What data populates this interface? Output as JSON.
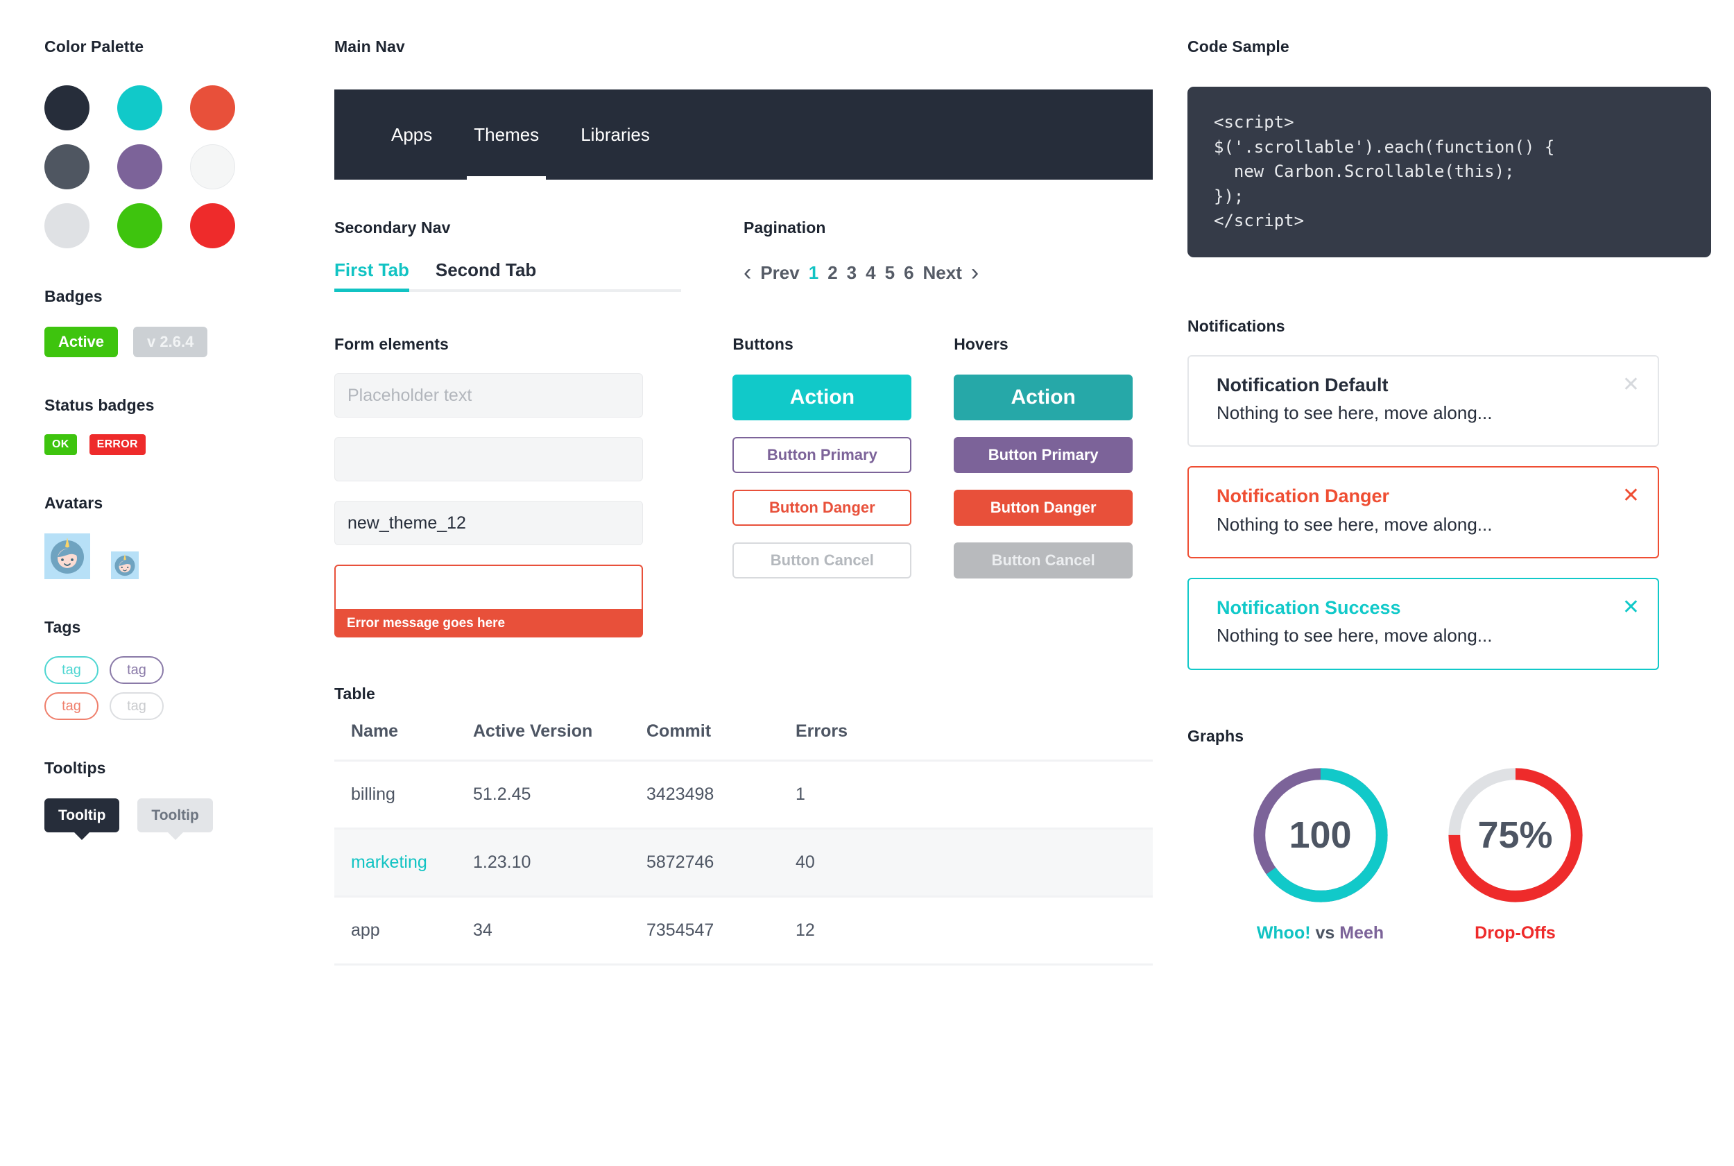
{
  "left": {
    "palette": {
      "title": "Color Palette",
      "swatches": [
        {
          "name": "dark-navy",
          "hex": "#262d3a",
          "ring": false
        },
        {
          "name": "teal",
          "hex": "#11c9c9",
          "ring": false
        },
        {
          "name": "coral",
          "hex": "#e8503a",
          "ring": false
        },
        {
          "name": "slate",
          "hex": "#4f5661",
          "ring": false
        },
        {
          "name": "purple",
          "hex": "#7c6399",
          "ring": false
        },
        {
          "name": "off-white",
          "hex": "#f5f6f6",
          "ring": true
        },
        {
          "name": "light-gray",
          "hex": "#dfe1e4",
          "ring": false
        },
        {
          "name": "green",
          "hex": "#3ec40e",
          "ring": false
        },
        {
          "name": "red",
          "hex": "#ee2b2b",
          "ring": false
        }
      ]
    },
    "badges": {
      "title": "Badges",
      "active_label": "Active",
      "active_color": "#3ec40e",
      "version_label": "v 2.6.4"
    },
    "status_badges": {
      "title": "Status badges",
      "ok_label": "OK",
      "ok_color": "#3ec40e",
      "error_label": "ERROR",
      "error_color": "#ee2b2b"
    },
    "avatars": {
      "title": "Avatars"
    },
    "tags": {
      "title": "Tags",
      "items": [
        {
          "label": "tag",
          "color": "#4fd6d2"
        },
        {
          "label": "tag",
          "color": "#8a7aa8"
        },
        {
          "label": "tag",
          "color": "#ef7f6c"
        },
        {
          "label": "tag",
          "color": "#c9cbce"
        }
      ]
    },
    "tooltips": {
      "title": "Tooltips",
      "dark_label": "Tooltip",
      "light_label": "Tooltip"
    }
  },
  "center": {
    "main_nav": {
      "title": "Main Nav",
      "items": [
        {
          "label": "Apps",
          "active": false
        },
        {
          "label": "Themes",
          "active": true
        },
        {
          "label": "Libraries",
          "active": false
        }
      ]
    },
    "secondary_nav": {
      "title": "Secondary Nav",
      "tabs": [
        {
          "label": "First Tab",
          "active": true
        },
        {
          "label": "Second Tab",
          "active": false
        }
      ]
    },
    "pagination": {
      "title": "Pagination",
      "prev_label": "Prev",
      "next_label": "Next",
      "prev_icon": "chevron-left-icon",
      "next_icon": "chevron-right-icon",
      "pages": [
        "1",
        "2",
        "3",
        "4",
        "5",
        "6"
      ],
      "current_page": "1"
    },
    "form": {
      "title": "Form elements",
      "placeholder": "Placeholder text",
      "empty_value": "",
      "filled_value": "new_theme_12",
      "error_value": "",
      "error_message": "Error message goes here"
    },
    "buttons": {
      "title": "Buttons",
      "action": "Action",
      "primary": "Button Primary",
      "danger": "Button Danger",
      "cancel": "Button Cancel"
    },
    "hovers": {
      "title": "Hovers",
      "action": "Action",
      "primary": "Button Primary",
      "danger": "Button Danger",
      "cancel": "Button Cancel"
    },
    "table": {
      "title": "Table",
      "columns": [
        "Name",
        "Active Version",
        "Commit",
        "Errors"
      ],
      "rows": [
        {
          "name": "billing",
          "version": "51.2.45",
          "commit": "3423498",
          "errors": "1",
          "highlight": false,
          "link": false
        },
        {
          "name": "marketing",
          "version": "1.23.10",
          "commit": "5872746",
          "errors": "40",
          "highlight": true,
          "link": true
        },
        {
          "name": "app",
          "version": "34",
          "commit": "7354547",
          "errors": "12",
          "highlight": false,
          "link": false
        }
      ]
    }
  },
  "right": {
    "code": {
      "title": "Code Sample",
      "body": "<script>\n$('.scrollable').each(function() {\n  new Carbon.Scrollable(this);\n});\n</script>"
    },
    "notifications": {
      "title": "Notifications",
      "items": [
        {
          "variant": "default",
          "title": "Notification Default",
          "body": "Nothing to see here, move along...",
          "close_icon": "close-icon"
        },
        {
          "variant": "danger",
          "title": "Notification Danger",
          "body": "Nothing to see here, move along...",
          "close_icon": "close-icon"
        },
        {
          "variant": "success",
          "title": "Notification Success",
          "body": "Nothing to see here, move along...",
          "close_icon": "close-icon"
        }
      ]
    },
    "graphs": {
      "title": "Graphs",
      "donut_one": {
        "center_value": "100",
        "label_part_a": "Whoo!",
        "label_vs": "vs",
        "label_part_b": "Meeh"
      },
      "donut_two": {
        "center_value": "75%",
        "label": "Drop-Offs"
      }
    }
  },
  "chart_data": [
    {
      "type": "pie",
      "title": "Whoo! vs Meeh",
      "center_label": "100",
      "categories": [
        "Whoo!",
        "Meeh"
      ],
      "values": [
        65,
        35
      ],
      "colors": [
        "#11c9c9",
        "#7c6399"
      ],
      "donut": true,
      "legend": "below"
    },
    {
      "type": "pie",
      "title": "Drop-Offs",
      "center_label": "75%",
      "categories": [
        "Drop-Offs",
        "Remaining"
      ],
      "values": [
        75,
        25
      ],
      "colors": [
        "#ee2b2b",
        "#dfe1e4"
      ],
      "donut": true,
      "legend": "below"
    }
  ]
}
